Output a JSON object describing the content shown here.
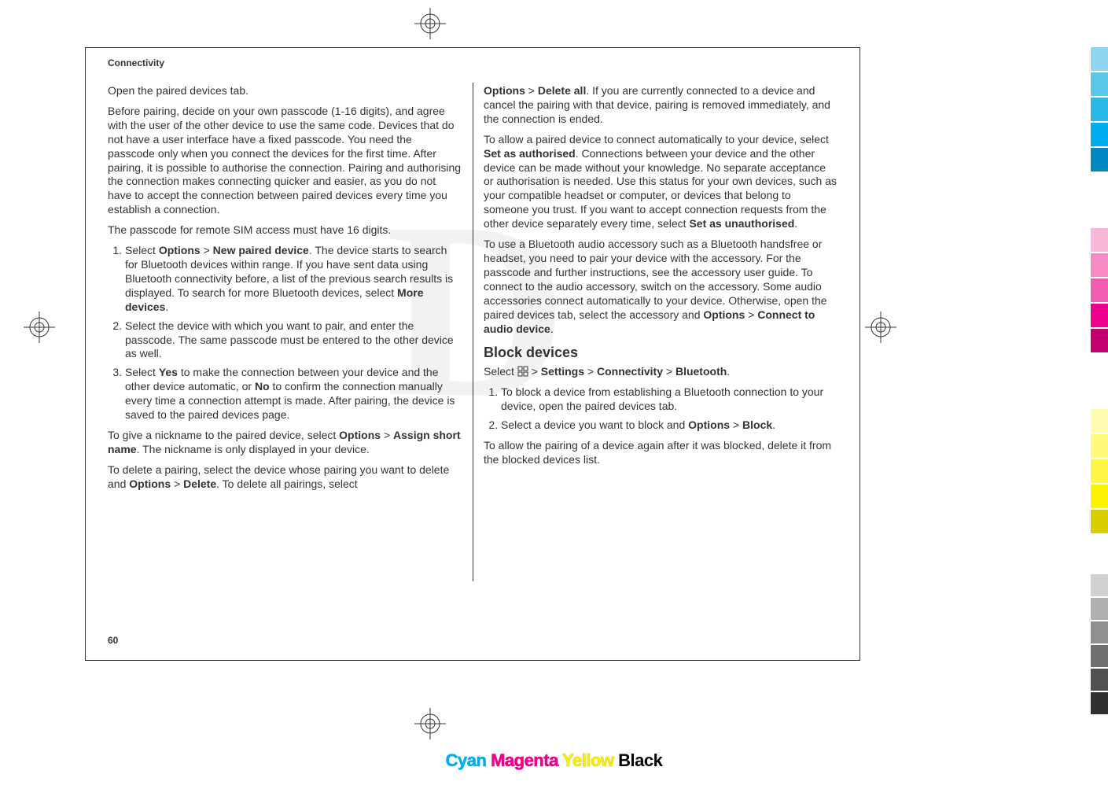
{
  "header": "Connectivity",
  "pageNumber": "60",
  "watermark": "D",
  "cmyk": {
    "cyan": "Cyan",
    "magenta": "Magenta",
    "yellow": "Yellow",
    "black": "Black"
  },
  "col1": {
    "p1": "Open the paired devices tab.",
    "p2": "Before pairing, decide on your own passcode (1-16 digits), and agree with the user of the other device to use the same code. Devices that do not have a user interface have a fixed passcode. You need the passcode only when you connect the devices for the first time. After pairing, it is possible to authorise the connection. Pairing and authorising the connection makes connecting quicker and easier, as you do not have to accept the connection between paired devices every time you establish a connection.",
    "p3": "The passcode for remote SIM access must have 16 digits.",
    "li1a": "Select ",
    "li1b": "Options",
    "li1c": " > ",
    "li1d": "New paired device",
    "li1e": ". The device starts to search for Bluetooth devices within range. If you have sent data using Bluetooth connectivity before, a list of the previous search results is displayed. To search for more Bluetooth devices, select ",
    "li1f": "More devices",
    "li1g": ".",
    "li2": "Select the device with which you want to pair, and enter the passcode. The same passcode must be entered to the other device as well.",
    "li3a": "Select ",
    "li3b": "Yes",
    "li3c": " to make the connection between your device and the other device automatic, or ",
    "li3d": "No",
    "li3e": " to confirm the connection manually every time a connection attempt is made. After pairing, the device is saved to the paired devices page.",
    "p4a": "To give a nickname to the paired device, select ",
    "p4b": "Options",
    "p4c": " > ",
    "p4d": "Assign short name",
    "p4e": ". The nickname is only displayed in your device.",
    "p5a": "To delete a pairing, select the device whose pairing you want to delete and ",
    "p5b": "Options",
    "p5c": " > ",
    "p5d": "Delete",
    "p5e": ". To delete all pairings, select"
  },
  "col2": {
    "p1a": "Options",
    "p1b": " > ",
    "p1c": "Delete all",
    "p1d": ". If you are currently connected to a device and cancel the pairing with that device, pairing is removed immediately, and the connection is ended.",
    "p2a": "To allow a paired device to connect automatically to your device, select ",
    "p2b": "Set as authorised",
    "p2c": ". Connections between your device and the other device can be made without your knowledge. No separate acceptance or authorisation is needed. Use this status for your own devices, such as your compatible headset or computer, or devices that belong to someone you trust. If you want to accept connection requests from the other device separately every time, select ",
    "p2d": "Set as unauthorised",
    "p2e": ".",
    "p3a": "To use a Bluetooth audio accessory such as a Bluetooth handsfree or headset, you need to pair your device with the accessory. For the passcode and further instructions, see the accessory user guide. To connect to the audio accessory, switch on the accessory. Some audio accessories connect automatically to your device. Otherwise, open the paired devices tab, select the accessory and ",
    "p3b": "Options",
    "p3c": " > ",
    "p3d": "Connect to audio device",
    "p3e": ".",
    "h2": "Block devices",
    "navA": "Select ",
    "navB": " > ",
    "navC": "Settings",
    "navD": " > ",
    "navE": "Connectivity",
    "navF": " > ",
    "navG": "Bluetooth",
    "navH": ".",
    "li1": "To block a device from establishing a Bluetooth connection to your device, open the paired devices tab.",
    "li2a": "Select a device you want to block and ",
    "li2b": "Options",
    "li2c": " > ",
    "li2d": "Block",
    "li2e": ".",
    "p4": "To allow the pairing of a device again after it was blocked, delete it from the blocked devices list."
  }
}
